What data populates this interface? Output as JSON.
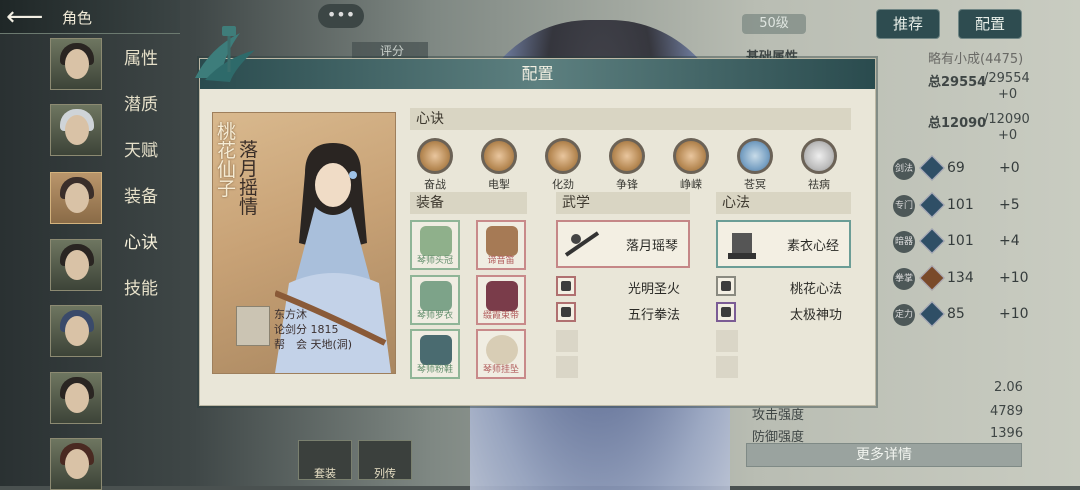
{
  "top": {
    "title": "角色",
    "chat_icon": "•••"
  },
  "sidebar": {
    "tabs": [
      "属性",
      "潜质",
      "天赋",
      "装备",
      "心诀",
      "技能"
    ],
    "active_tab": "心诀"
  },
  "header": {
    "level": "50级",
    "score_label": "评分 4475",
    "recommend_label": "推荐",
    "config_label": "配置"
  },
  "right_panel": {
    "base_title": "基础属性",
    "base_value": "略有小成(4475)",
    "total1_label": "总29554",
    "total1_max": "/29554",
    "total1_plus": "+0",
    "total2_label": "总12090",
    "total2_max": "/12090",
    "total2_plus": "+0",
    "stats": [
      {
        "name": "剑法",
        "value": "69",
        "plus": "+0"
      },
      {
        "name": "专门",
        "value": "101",
        "plus": "+5"
      },
      {
        "name": "暗器",
        "value": "101",
        "plus": "+4"
      },
      {
        "name": "拳掌",
        "value": "134",
        "plus": "+10"
      },
      {
        "name": "定力",
        "value": "85",
        "plus": "+10"
      }
    ],
    "extra": [
      {
        "label": "",
        "value": "2.06"
      },
      {
        "label": "攻击强度",
        "value": "4789"
      },
      {
        "label": "防御强度",
        "value": "1396"
      }
    ],
    "more_label": "更多详情"
  },
  "bottom_tabs": [
    "套装",
    "列传"
  ],
  "dialog": {
    "title": "配置",
    "card": {
      "name_main": "桃花仙子",
      "name_sub": "落月摇情",
      "owner_name": "东方沐",
      "owner_score": "论剑分 1815",
      "owner_guild": "帮　会 天地(洞)"
    },
    "xinjue_title": "心诀",
    "xinjue": [
      "奋战",
      "电掣",
      "化劲",
      "争锋",
      "峥嵘",
      "苍冥",
      "祛病"
    ],
    "equip_title": "装备",
    "equip": [
      {
        "name": "琴师头冠",
        "rarity": "green"
      },
      {
        "name": "谛音笛",
        "rarity": "red"
      },
      {
        "name": "琴师罗衣",
        "rarity": "green"
      },
      {
        "name": "缀霞束带",
        "rarity": "red"
      },
      {
        "name": "琴师粉鞋",
        "rarity": "green"
      },
      {
        "name": "琴师挂坠",
        "rarity": "red"
      }
    ],
    "wuxue_title": "武学",
    "wuxue_main": "落月瑶琴",
    "wuxue_list": [
      "光明圣火",
      "五行拳法"
    ],
    "xinfa_title": "心法",
    "xinfa_main": "素衣心经",
    "xinfa_list": [
      "桃花心法",
      "太极神功"
    ]
  }
}
